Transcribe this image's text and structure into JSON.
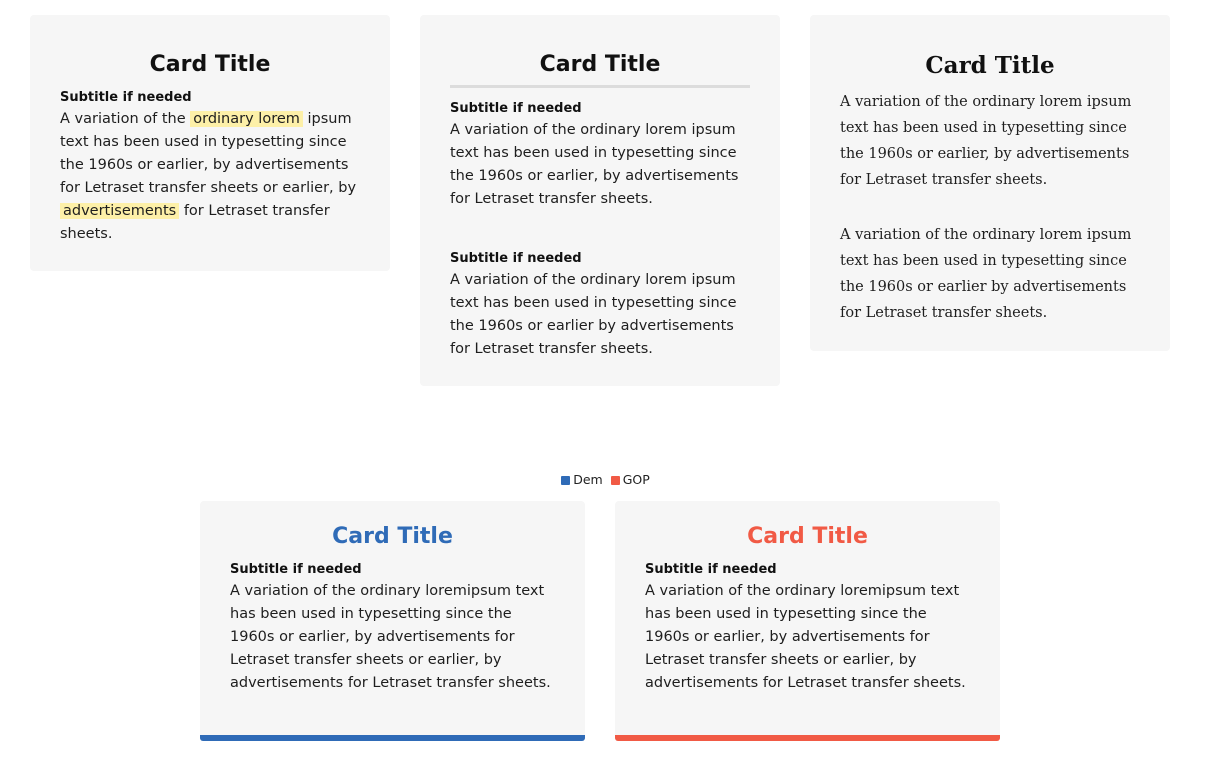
{
  "colors": {
    "dem": "#2f6bb7",
    "gop": "#f15a45",
    "card_bg": "#f6f6f6",
    "highlight": "#fdf0a8"
  },
  "card1": {
    "title": "Card Title",
    "subtitle": "Subtitle if needed",
    "body_part1": "A variation of the ",
    "highlight1": "ordinary lorem",
    "body_part2": " ipsum text has been used in typesetting since the 1960s or earlier, by advertisements for Letraset transfer sheets or earlier, by ",
    "highlight2": "advertisements",
    "body_part3": " for Letraset transfer sheets."
  },
  "card2": {
    "title": "Card Title",
    "section1_subtitle": "Subtitle if needed",
    "section1_body": "A variation of the ordinary lorem ipsum text has been used in typesetting since the 1960s or earlier, by advertisements for Letraset transfer sheets.",
    "section2_subtitle": "Subtitle if needed",
    "section2_body": "A variation of the ordinary lorem ipsum text has been used in typesetting since the 1960s or earlier by advertisements for Letraset transfer sheets."
  },
  "card3": {
    "title": "Card Title",
    "paragraph1": "A variation of the ordinary lorem ipsum text has been used in typesetting since the 1960s or earlier, by advertisements for Letraset transfer sheets.",
    "paragraph2": "A variation of the ordinary lorem ipsum text has been used in typesetting since the 1960s or earlier by advertisements for Letraset transfer sheets."
  },
  "legend": {
    "dem_label": "Dem",
    "gop_label": "GOP"
  },
  "dem_card": {
    "title": "Card Title",
    "subtitle": "Subtitle if needed",
    "body": "A variation of the ordinary loremipsum text has been used in typesetting since the 1960s or earlier, by advertisements for Letraset transfer sheets or earlier, by advertisements for Letraset transfer sheets."
  },
  "gop_card": {
    "title": "Card Title",
    "subtitle": "Subtitle if needed",
    "body": "A variation of the ordinary loremipsum text has been used in typesetting since the 1960s or earlier, by advertisements for Letraset transfer sheets or earlier, by advertisements for Letraset transfer sheets."
  }
}
